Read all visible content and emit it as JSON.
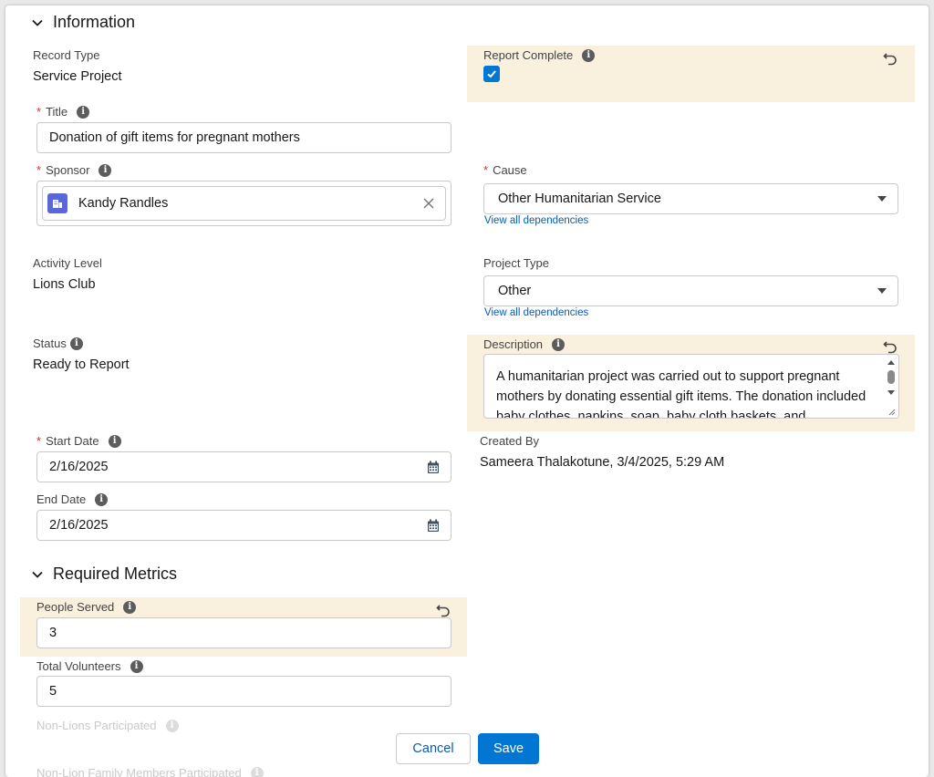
{
  "sections": {
    "information": "Information",
    "required_metrics": "Required Metrics"
  },
  "fields": {
    "record_type": {
      "label": "Record Type",
      "value": "Service Project"
    },
    "report_complete": {
      "label": "Report Complete",
      "checked": true
    },
    "title": {
      "label": "Title",
      "value": "Donation of gift items for pregnant mothers",
      "required": "*"
    },
    "sponsor": {
      "label": "Sponsor",
      "value": "Kandy Randles",
      "required": "*"
    },
    "cause": {
      "label": "Cause",
      "value": "Other Humanitarian Service",
      "required": "*",
      "link": "View all dependencies"
    },
    "activity_level": {
      "label": "Activity Level",
      "value": "Lions Club"
    },
    "project_type": {
      "label": "Project Type",
      "value": "Other",
      "link": "View all dependencies"
    },
    "status": {
      "label": "Status",
      "value": "Ready to Report"
    },
    "description": {
      "label": "Description",
      "value": "A humanitarian project was carried out to support pregnant mothers by donating essential gift items. The donation included baby clothes, napkins, soap, baby cloth baskets, and"
    },
    "start_date": {
      "label": "Start Date",
      "value": "2/16/2025",
      "required": "*"
    },
    "end_date": {
      "label": "End Date",
      "value": "2/16/2025"
    },
    "created_by": {
      "label": "Created By",
      "value": "Sameera Thalakotune, 3/4/2025, 5:29 AM"
    },
    "people_served": {
      "label": "People Served",
      "value": "3"
    },
    "total_volunteers": {
      "label": "Total Volunteers",
      "value": "5"
    },
    "non_lions_participated": {
      "label": "Non-Lions Participated"
    },
    "non_lion_family": {
      "label": "Non-Lion Family Members Participated"
    }
  },
  "buttons": {
    "cancel": "Cancel",
    "save": "Save"
  },
  "icons": {
    "info": "i"
  },
  "colors": {
    "brand": "#0176d3",
    "link": "#0b5cab",
    "highlight": "#faf0de",
    "required": "#c23934"
  }
}
